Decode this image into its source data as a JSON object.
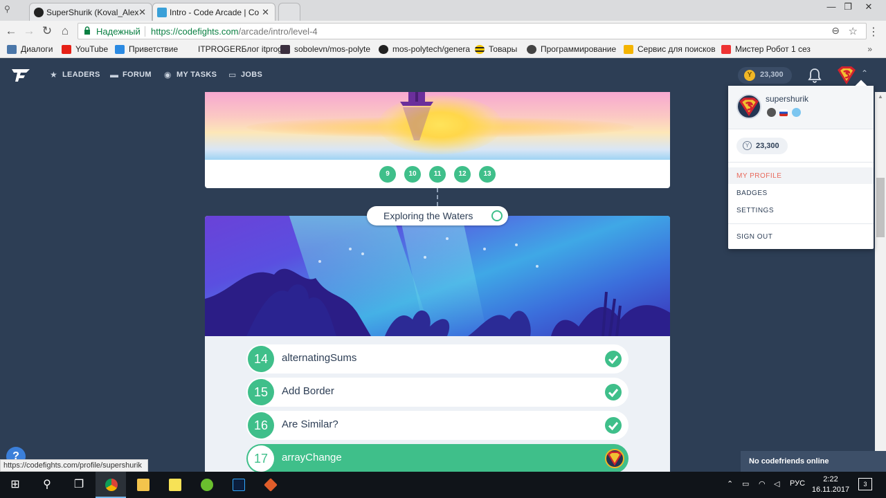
{
  "browser": {
    "tabs": [
      {
        "label": "SuperShurik (Koval_Alex",
        "active": false
      },
      {
        "label": "Intro - Code Arcade | Co",
        "active": true
      }
    ],
    "secure_label": "Надежный",
    "url_host": "https://codefights.com",
    "url_path": "/arcade/intro/level-4",
    "bookmarks": [
      {
        "label": "Диалоги",
        "icon": "vk-icon"
      },
      {
        "label": "YouTube",
        "icon": "youtube-icon"
      },
      {
        "label": "Приветствие",
        "icon": "dropbox-icon"
      },
      {
        "label": "ITPROGERБлог itprog",
        "icon": "page-icon"
      },
      {
        "label": "sobolevn/mos-polyte",
        "icon": "app-icon"
      },
      {
        "label": "mos-polytech/genera",
        "icon": "github-icon"
      },
      {
        "label": "Товары",
        "icon": "beeline-icon"
      },
      {
        "label": "Программирование",
        "icon": "people-icon"
      },
      {
        "label": "Сервис для поисков",
        "icon": "yellow-icon"
      },
      {
        "label": "Мистер Робот 1 сез",
        "icon": "video-icon"
      }
    ],
    "bookmarks_more": "»",
    "status_url": "https://codefights.com/profile/supershurik"
  },
  "header": {
    "nav": [
      {
        "label": "LEADERS",
        "icon": "star-icon"
      },
      {
        "label": "FORUM",
        "icon": "chat-icon"
      },
      {
        "label": "MY TASKS",
        "icon": "tasks-icon"
      },
      {
        "label": "JOBS",
        "icon": "briefcase-icon"
      }
    ],
    "coins": "23,300"
  },
  "level_card": {
    "levels": [
      "9",
      "10",
      "11",
      "12",
      "13"
    ]
  },
  "topic": {
    "title": "Exploring the Waters"
  },
  "tasks": [
    {
      "number": "14",
      "name": "alternatingSums",
      "status": "done"
    },
    {
      "number": "15",
      "name": "Add Border",
      "status": "done"
    },
    {
      "number": "16",
      "name": "Are Similar?",
      "status": "done"
    },
    {
      "number": "17",
      "name": "arrayChange",
      "status": "current"
    }
  ],
  "dropdown": {
    "username": "supershurik",
    "coins": "23,300",
    "items": [
      {
        "label": "MY PROFILE",
        "active": true
      },
      {
        "label": "BADGES",
        "active": false
      },
      {
        "label": "SETTINGS",
        "active": false
      },
      {
        "label": "SIGN OUT",
        "active": false
      }
    ]
  },
  "help_label": "?",
  "codefriends": "No codefriends online",
  "taskbar": {
    "lang": "РУС",
    "time": "2:22",
    "date": "16.11.2017",
    "notifications": "3"
  },
  "colors": {
    "accent_green": "#3fbf8a",
    "nav_bg": "#2d3e55",
    "coin_gold": "#f1b726",
    "active_menu_red": "#e8685a"
  }
}
